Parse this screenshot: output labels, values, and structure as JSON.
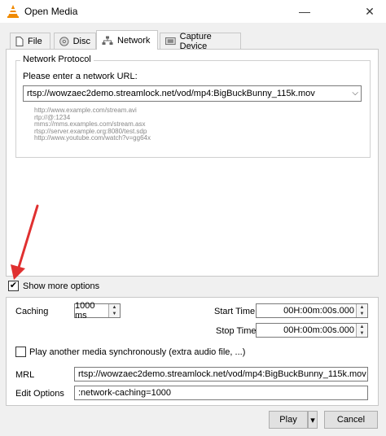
{
  "window": {
    "title": "Open Media",
    "minimize": "—",
    "close": "✕"
  },
  "tabs": [
    {
      "label": "File",
      "icon": "file-icon"
    },
    {
      "label": "Disc",
      "icon": "disc-icon"
    },
    {
      "label": "Network",
      "icon": "network-icon",
      "active": true
    },
    {
      "label": "Capture Device",
      "icon": "capture-device-icon"
    }
  ],
  "network": {
    "group_label": "Network Protocol",
    "prompt": "Please enter a network URL:",
    "url_value": "rtsp://wowzaec2demo.streamlock.net/vod/mp4:BigBuckBunny_115k.mov",
    "examples": [
      "http://www.example.com/stream.avi",
      "rtp://@:1234",
      "mms://mms.examples.com/stream.asx",
      "rtsp://server.example.org:8080/test.sdp",
      "http://www.youtube.com/watch?v=gg64x"
    ]
  },
  "options": {
    "show_more_label": "Show more options",
    "show_more_checked": true,
    "caching_label": "Caching",
    "caching_value": "1000 ms",
    "start_time_label": "Start Time",
    "start_time_value": "00H:00m:00s.000",
    "stop_time_label": "Stop Time",
    "stop_time_value": "00H:00m:00s.000",
    "sync_label": "Play another media synchronously (extra audio file, ...)",
    "sync_checked": false,
    "mrl_label": "MRL",
    "mrl_value": "rtsp://wowzaec2demo.streamlock.net/vod/mp4:BigBuckBunny_115k.mov",
    "edit_options_label": "Edit Options",
    "edit_options_value": ":network-caching=1000"
  },
  "buttons": {
    "play": "Play",
    "play_dropdown": "▾",
    "cancel": "Cancel"
  },
  "annotation": {
    "color": "#e03030",
    "icon": "red-arrow"
  }
}
